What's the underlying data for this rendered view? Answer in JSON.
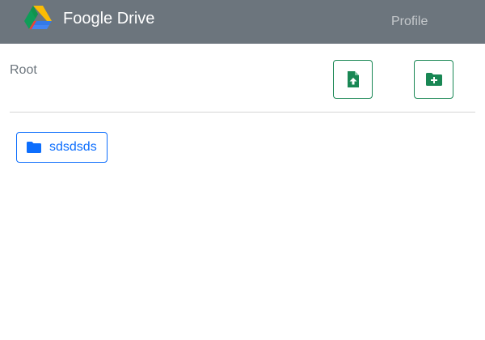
{
  "header": {
    "brand_name": "Foogle Drive",
    "logo_icon": "google-drive-logo",
    "profile_label": "Profile"
  },
  "breadcrumb": {
    "root_label": "Root"
  },
  "actions": {
    "upload_icon": "file-upload-icon",
    "new_folder_icon": "folder-plus-icon",
    "accent_color": "#198754"
  },
  "folders": [
    {
      "name": "sdsdsds",
      "icon": "folder-icon"
    }
  ],
  "colors": {
    "navbar": "#6c757d",
    "folder_accent": "#0d6efd"
  }
}
